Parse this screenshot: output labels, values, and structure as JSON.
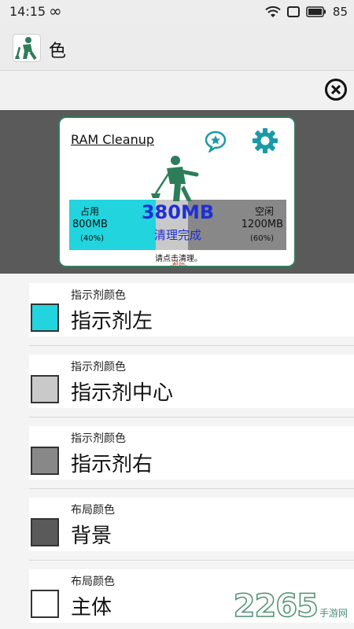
{
  "status": {
    "time": "14:15",
    "loop": "∞",
    "battery": "85"
  },
  "app": {
    "title": "色"
  },
  "widget": {
    "title": "RAM Cleanup",
    "used_label": "占用",
    "used_value": "800MB",
    "used_pct": "(40%)",
    "free_label": "空闲",
    "free_value": "1200MB",
    "free_pct": "(60%)",
    "cleaned_amount": "380MB",
    "status_text": "清理完成",
    "hint": "请点击清理。",
    "help": "-帮助-",
    "used_fraction": 0.4
  },
  "rows": [
    {
      "subtitle": "指示剂颜色",
      "title": "指示剂左",
      "color": "#22d4de"
    },
    {
      "subtitle": "指示剂颜色",
      "title": "指示剂中心",
      "color": "#c9c9c9"
    },
    {
      "subtitle": "指示剂颜色",
      "title": "指示剂右",
      "color": "#888888"
    },
    {
      "subtitle": "布局颜色",
      "title": "背景",
      "color": "#5a5a5a"
    },
    {
      "subtitle": "布局颜色",
      "title": "主体",
      "color": "#ffffff"
    }
  ],
  "watermark": {
    "number": "2265",
    "suffix": "手游网"
  },
  "colors": {
    "accent": "#22d4de",
    "brand_green": "#2e7d5a",
    "text_blue": "#1f2fd6",
    "help_red": "#c0392b"
  }
}
